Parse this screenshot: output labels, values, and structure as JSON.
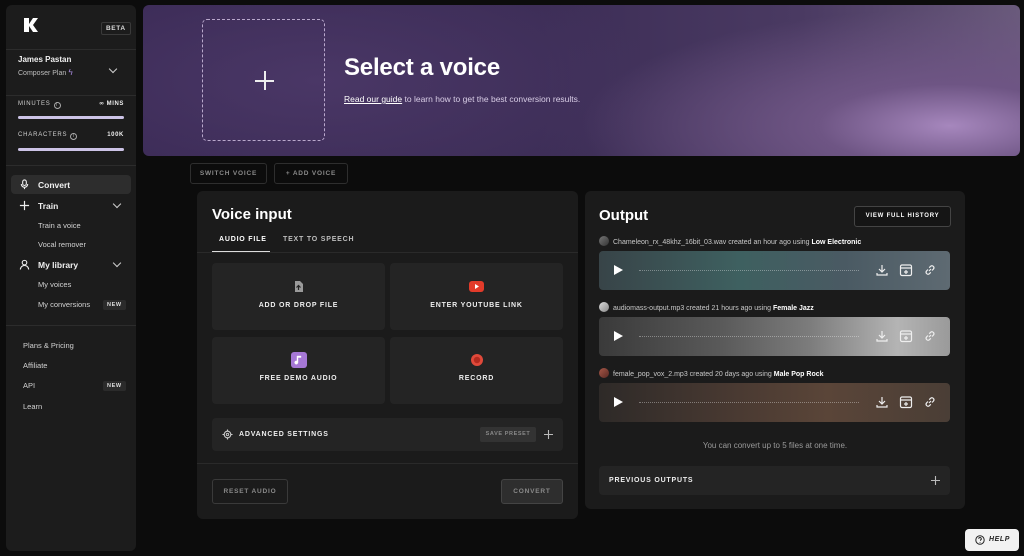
{
  "sidebar": {
    "beta": "BETA",
    "user_name": "James Pastan",
    "user_plan": "Composer Plan",
    "minutes_label": "MINUTES",
    "minutes_value": "∞ MINS",
    "characters_label": "CHARACTERS",
    "characters_value": "100K",
    "nav": {
      "convert": "Convert",
      "train": "Train",
      "train_voice": "Train a voice",
      "vocal_remover": "Vocal remover",
      "library": "My library",
      "my_voices": "My voices",
      "my_conversions": "My conversions",
      "new": "NEW"
    },
    "footer": {
      "plans": "Plans & Pricing",
      "affiliate": "Affiliate",
      "api": "API",
      "api_new": "NEW",
      "learn": "Learn"
    }
  },
  "banner": {
    "title": "Select a voice",
    "guide_link": "Read our guide",
    "subtitle_rest": " to learn how to get the best conversion results."
  },
  "voice_buttons": {
    "switch": "SWITCH VOICE",
    "add": "ADD VOICE"
  },
  "voice_input": {
    "title": "Voice input",
    "tabs": [
      "AUDIO FILE",
      "TEXT TO SPEECH"
    ],
    "tiles": {
      "add_file": "ADD OR DROP FILE",
      "youtube": "ENTER YOUTUBE LINK",
      "demo": "FREE DEMO AUDIO",
      "record": "RECORD"
    },
    "advanced": "ADVANCED SETTINGS",
    "save_preset": "SAVE PRESET",
    "reset": "RESET AUDIO",
    "convert": "CONVERT"
  },
  "output": {
    "title": "Output",
    "history": "VIEW FULL HISTORY",
    "items": [
      {
        "file": "Chameleon_rx_48khz_16bit_03.wav",
        "when": " created an hour ago using ",
        "voice": "Low Electronic"
      },
      {
        "file": "audiomass-output.mp3",
        "when": " created 21 hours ago using ",
        "voice": "Female Jazz"
      },
      {
        "file": "female_pop_vox_2.mp3",
        "when": " created 20 days ago using ",
        "voice": "Male Pop Rock"
      }
    ],
    "limit_note": "You can convert up to 5 files at one time.",
    "previous": "PREVIOUS OUTPUTS"
  },
  "help": "HELP",
  "colors": {
    "meter_fill": "#ccc3e6",
    "youtube_red": "#e23b2a",
    "demo_purple": "#a678d6",
    "record_red": "#e0493a"
  }
}
